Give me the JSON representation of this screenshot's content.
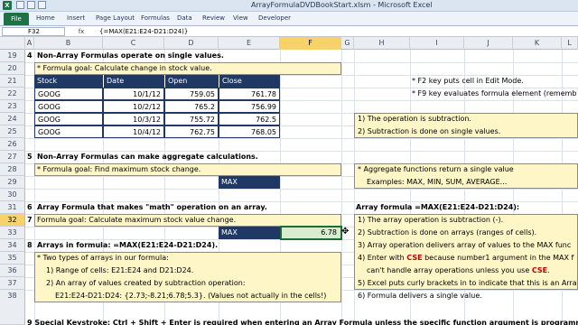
{
  "window": {
    "title": "ArrayFormulaDVDBookStart.xlsm - Microsoft Excel",
    "app_icon_letter": "X"
  },
  "ribbon": {
    "file_label": "File",
    "tabs": [
      "Home",
      "Insert",
      "Page Layout",
      "Formulas",
      "Data",
      "Review",
      "View",
      "Developer"
    ]
  },
  "formula_bar": {
    "name_box": "F32",
    "fx_label": "fx",
    "formula": "{=MAX(E21:E24-D21:D24)}"
  },
  "columns": [
    "A",
    "B",
    "C",
    "D",
    "E",
    "F",
    "G",
    "H",
    "I",
    "J",
    "K",
    "L"
  ],
  "active_column": "F",
  "rows": [
    "19",
    "20",
    "21",
    "22",
    "23",
    "24",
    "25",
    "26",
    "27",
    "28",
    "29",
    "30",
    "31",
    "32",
    "33",
    "34",
    "35",
    "36",
    "37",
    "38"
  ],
  "active_row": "32",
  "sheet": {
    "s4_num": "4",
    "s4_heading": "Non-Array Formulas operate on single values.",
    "s4_goal": "* Formula goal: Calculate change in stock value.",
    "table_headers": [
      "Stock",
      "Date",
      "Open",
      "Close"
    ],
    "table_rows": [
      [
        "GOOG",
        "10/1/12",
        "759.05",
        "761.78"
      ],
      [
        "GOOG",
        "10/2/12",
        "765.2",
        "756.99"
      ],
      [
        "GOOG",
        "10/3/12",
        "755.72",
        "762.5"
      ],
      [
        "GOOG",
        "10/4/12",
        "762.75",
        "768.05"
      ]
    ],
    "note_f2": "* F2 key puts cell in Edit Mode.",
    "note_f9": "* F9 key evaluates formula element (rememb",
    "box1_line1": "1) The operation is subtraction.",
    "box1_line2": "2) Subtraction is done on single values.",
    "s5_num": "5",
    "s5_heading": "Non-Array Formulas can make aggregate calculations.",
    "s5_goal": "* Formula goal: Find maximum stock change.",
    "max1_label": "MAX",
    "agg_line1": "* Aggregate functions return a single value",
    "agg_line2": "Examples: MAX, MIN, SUM, AVERAGE...",
    "s6_num": "6",
    "s6_heading": "Array Formula that makes \"math\" operation on an array.",
    "s7_num": "7",
    "s7_goal": "Formula goal: Calculate maximum stock value change.",
    "array_formula_title": "Array formula =MAX(E21:E24-D21:D24):",
    "max2_label": "MAX",
    "max2_value": "6.78",
    "af_1": "1) The array operation is subtraction (-).",
    "af_2": "2) Subtraction is done on arrays (ranges of cells).",
    "af_3": "3) Array operation delivers array of values to the MAX func",
    "af_4a": "4) Enter with ",
    "af_4cse": "CSE",
    "af_4b": " because number1 argument in the MAX f",
    "af_4c": "can't handle array operations unless you use ",
    "af_4cse2": "CSE",
    "af_4d": ".",
    "af_5": "5) Excel puts curly brackets in to indicate that this is an Arra",
    "af_6": "6) Formula delivers a single value.",
    "s8_num": "8",
    "s8_heading": "Arrays in formula: =MAX(E21:E24-D21:D24).",
    "s8_l1": "* Two types of arrays in our formula:",
    "s8_l2": "1) Range of cells: E21:E24  and  D21:D24.",
    "s8_l3": "2) An array of values created by subtraction operation:",
    "s8_l4": "E21:E24-D21:D24:  {2.73;-8.21;6.78;5.3}.    (Values not actually in the cells!)",
    "s9_partial": "9  Special Keystroke: Ctrl + Shift + Enter  is required when entering an Array Formula unless the specific function argument is programmed to"
  },
  "colors": {
    "excel_green": "#1e7145",
    "navy": "#1f3864",
    "yellow_box": "#fff6c8",
    "selection": "#1e6b3a",
    "cse_red": "#c00000"
  }
}
